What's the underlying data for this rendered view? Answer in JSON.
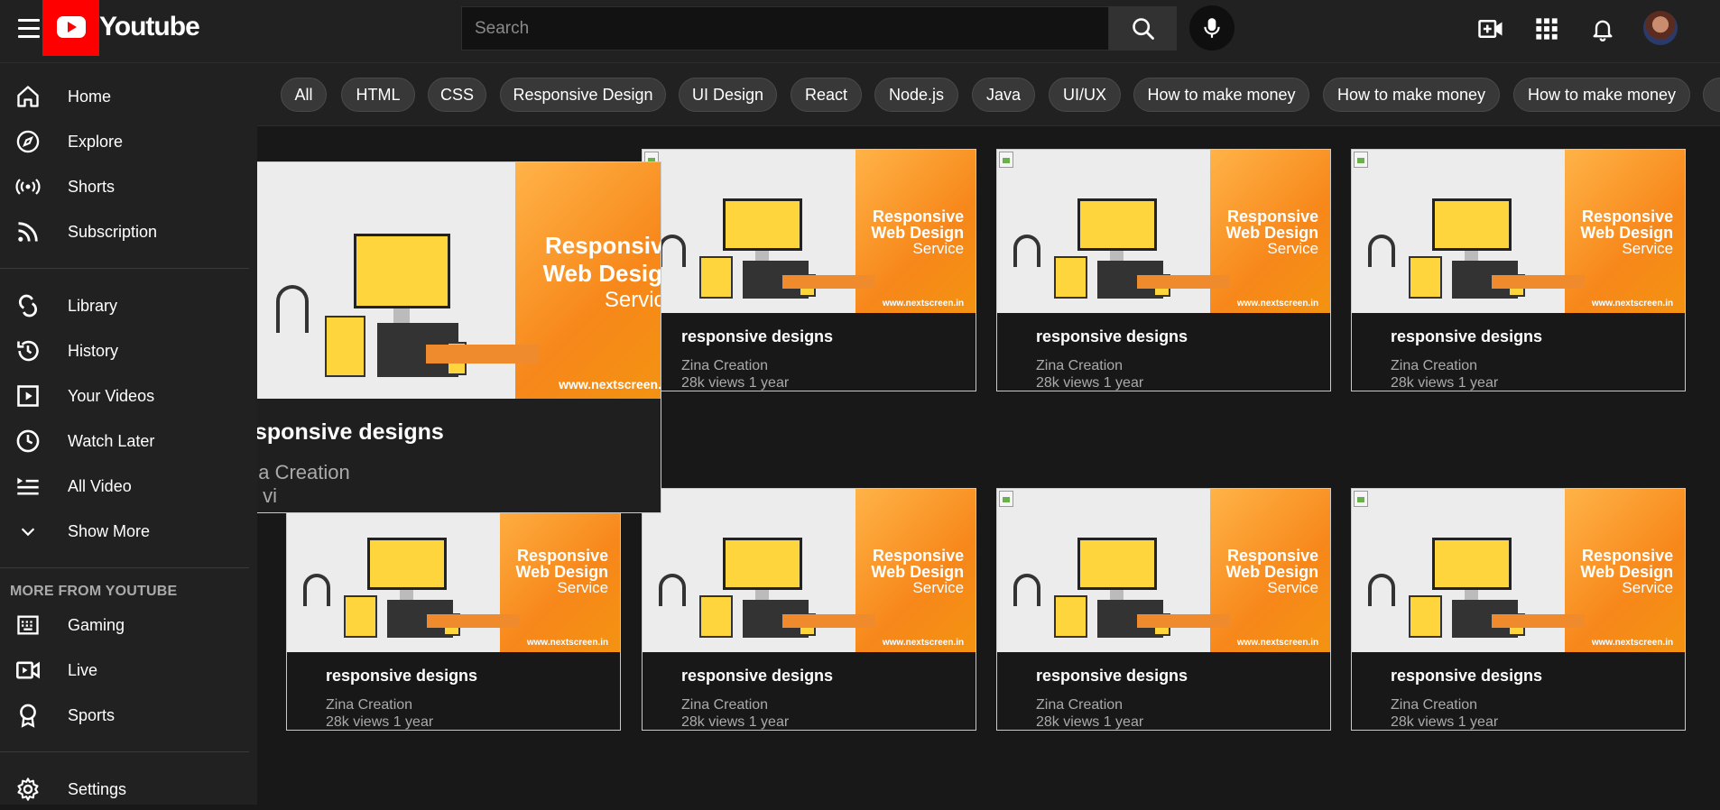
{
  "header": {
    "logo_text": "Youtube",
    "search_placeholder": "Search"
  },
  "sidebar": {
    "items": [
      {
        "label": "Home",
        "icon": "home-icon"
      },
      {
        "label": "Explore",
        "icon": "compass-icon"
      },
      {
        "label": "Shorts",
        "icon": "broadcast-icon"
      },
      {
        "label": "Subscription",
        "icon": "rss-icon"
      },
      {
        "label": "Library",
        "icon": "library-icon"
      },
      {
        "label": "History",
        "icon": "history-icon"
      },
      {
        "label": "Your Videos",
        "icon": "play-square-icon"
      },
      {
        "label": "Watch Later",
        "icon": "clock-icon"
      },
      {
        "label": "All Video",
        "icon": "playlist-icon"
      },
      {
        "label": "Show More",
        "icon": "chevron-down-icon"
      }
    ],
    "more_section_title": "MORE FROM YOUTUBE",
    "more_items": [
      {
        "label": "Gaming",
        "icon": "gaming-icon"
      },
      {
        "label": "Live",
        "icon": "live-camera-icon"
      },
      {
        "label": "Sports",
        "icon": "trophy-icon"
      }
    ],
    "settings_label": "Settings"
  },
  "chips": [
    "All",
    "HTML",
    "CSS",
    "Responsive Design",
    "UI Design",
    "React",
    "Node.js",
    "Java",
    "UI/UX",
    "How to make money",
    "How to make money",
    "How to make money"
  ],
  "video": {
    "title": "responsive designs",
    "channel": "Zina Creation",
    "meta": "28k views  1 year",
    "thumb_line1": "Responsive",
    "thumb_line2": "Web Design",
    "thumb_line3": "Service",
    "thumb_url": "www.nextscreen.in"
  },
  "big_card": {
    "title": "sponsive designs",
    "channel": "na Creation",
    "meta": "k vi"
  },
  "colors": {
    "accent": "#ff0000",
    "background": "#181818",
    "panel": "#212121",
    "thumb_orange": "#f7871a"
  }
}
